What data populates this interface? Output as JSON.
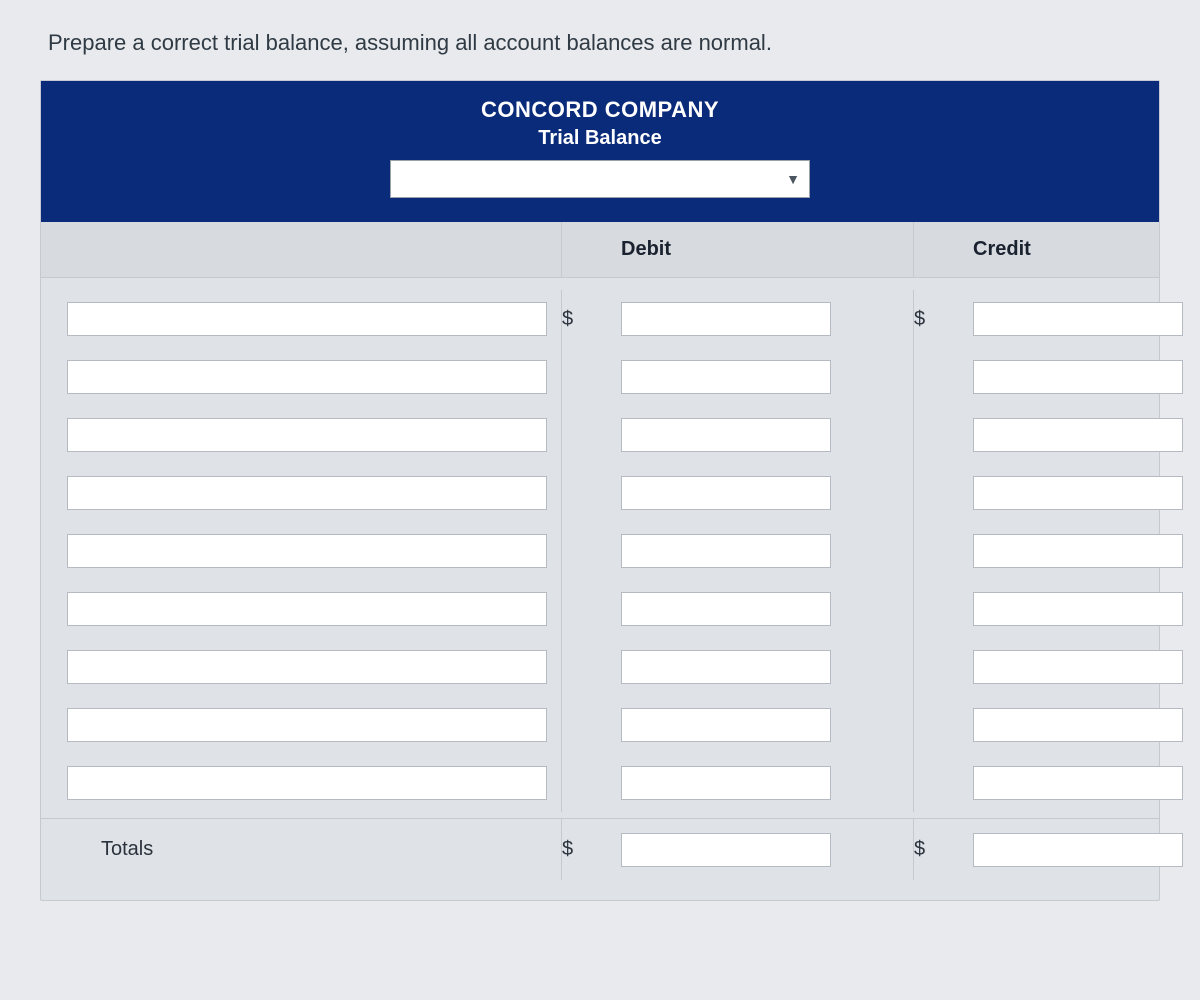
{
  "prompt": "Prepare a correct trial balance, assuming all account balances are normal.",
  "header": {
    "company": "CONCORD COMPANY",
    "subtitle": "Trial Balance",
    "date_value": ""
  },
  "columns": {
    "debit": "Debit",
    "credit": "Credit"
  },
  "currency_symbol": "$",
  "rows": [
    {
      "account": "",
      "debit": "",
      "credit": ""
    },
    {
      "account": "",
      "debit": "",
      "credit": ""
    },
    {
      "account": "",
      "debit": "",
      "credit": ""
    },
    {
      "account": "",
      "debit": "",
      "credit": ""
    },
    {
      "account": "",
      "debit": "",
      "credit": ""
    },
    {
      "account": "",
      "debit": "",
      "credit": ""
    },
    {
      "account": "",
      "debit": "",
      "credit": ""
    },
    {
      "account": "",
      "debit": "",
      "credit": ""
    },
    {
      "account": "",
      "debit": "",
      "credit": ""
    }
  ],
  "totals": {
    "label": "Totals",
    "debit": "",
    "credit": ""
  }
}
